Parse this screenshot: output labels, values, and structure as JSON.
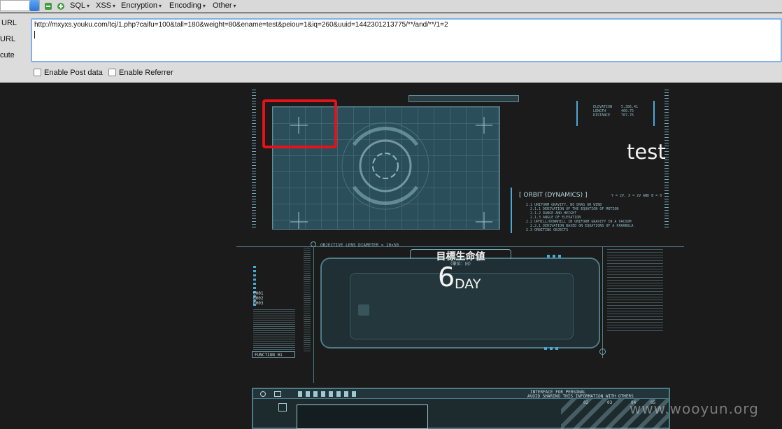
{
  "toolbar": {
    "menus": [
      "SQL",
      "XSS",
      "Encryption",
      "Encoding",
      "Other"
    ]
  },
  "panel": {
    "side_labels": [
      "URL",
      "URL",
      "cute"
    ],
    "url_value": "http://mxyxs.youku.com/tcj/1.php?caifu=100&tall=180&weight=80&ename=test&peiou=1&iq=260&uuid=1442301213775/**/and/**/1=2",
    "enable_post_label": "Enable Post data",
    "enable_referrer_label": "Enable Referrer"
  },
  "hud": {
    "name_text": "test",
    "orbit_title": "[ ORBIT (DYNAMICS) ]",
    "orbit_subtitle": "Y = 2V, X = 2V AND B = 0",
    "orbit_lines": [
      "2.1 UNIFORM GRAVITY, NO DRAG OR WIND",
      "2.1.1 DERIVATION OF THE EQUATION OF MOTION",
      "2.1.2 RANGE AND HEIGHT",
      "2.1.3 ANGLE OF ELEVATION",
      "2.2 UPHILL/DOWNHILL IN UNIFORM GRAVITY IN A VACUUM",
      "2.2.1 DERIVATION BASED ON EQUATIONS OF A PARABOLA",
      "2.3 ORBITING OBJECTS"
    ],
    "elev_labels": [
      "ELEVATION",
      "LENGTH",
      "DISTANCE"
    ],
    "elev_values": [
      "5,386.41",
      "460.75",
      "707.76"
    ],
    "lens_label": "OBJECTIVE LENS DIAMETER = 10×50",
    "life_title": "目標生命値",
    "life_unit_hint": "（單位：日）",
    "life_number": "6",
    "life_unit": "DAY",
    "left_codes": [
      "0001",
      "0002",
      "0003"
    ],
    "function_label": "FUNCTION_01",
    "bottom_right_lines": [
      "INTERFACE FOR PERSONAL",
      "AVOID SHARING THIS INFORMATION WITH OTHERS"
    ],
    "bottom_nums": [
      "02",
      "03",
      "04",
      "05"
    ]
  },
  "watermark": "www.wooyun.org",
  "colors": {
    "highlight_red": "#e3121b",
    "hud_teal": "#2b4f5a",
    "url_focus": "#7fb1e8"
  }
}
